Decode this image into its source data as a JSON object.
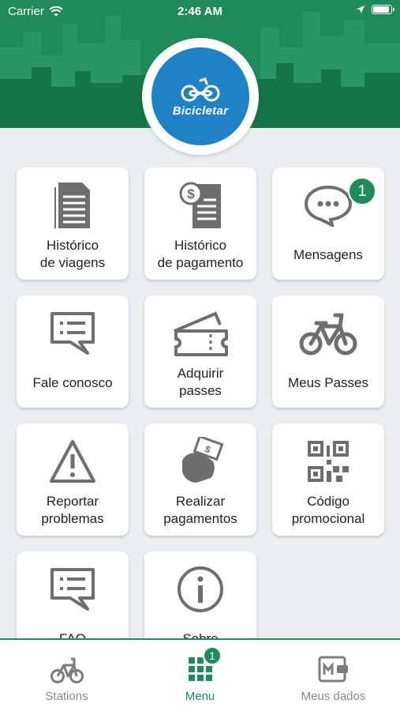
{
  "status_bar": {
    "carrier": "Carrier",
    "time": "2:46 AM",
    "battery_level": 0.95
  },
  "brand": {
    "name": "Bicicletar",
    "color": "#1f82c6",
    "accent": "#1f8a5a"
  },
  "menu": {
    "tiles": [
      {
        "label": "Histórico\nde viagens",
        "icon": "document-icon"
      },
      {
        "label": "Histórico\nde pagamento",
        "icon": "receipt-dollar-icon"
      },
      {
        "label": "Mensagens",
        "icon": "chat-bubble-icon",
        "badge": "1"
      },
      {
        "label": "Fale conosco",
        "icon": "message-icon"
      },
      {
        "label": "Adquirir\npasses",
        "icon": "ticket-icon"
      },
      {
        "label": "Meus Passes",
        "icon": "bicycle-icon"
      },
      {
        "label": "Reportar\nproblemas",
        "icon": "warning-icon"
      },
      {
        "label": "Realizar\npagamentos",
        "icon": "cash-hand-icon"
      },
      {
        "label": "Código\npromocional",
        "icon": "qr-code-icon"
      },
      {
        "label": "FAQ",
        "icon": "faq-message-icon"
      },
      {
        "label": "Sobre",
        "icon": "info-icon"
      }
    ]
  },
  "tabbar": {
    "tabs": [
      {
        "label": "Stations",
        "icon": "bicycle-icon"
      },
      {
        "label": "Menu",
        "icon": "grid-icon",
        "badge": "1",
        "active": true
      },
      {
        "label": "Meus dados",
        "icon": "wallet-card-icon"
      }
    ]
  }
}
